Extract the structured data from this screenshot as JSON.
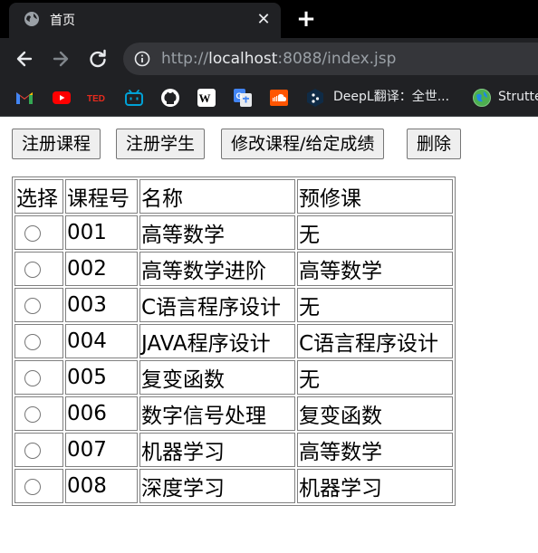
{
  "browser": {
    "tab_title": "首页",
    "tab_close": "✕",
    "new_tab": "+",
    "url_scheme": "http://",
    "url_host": "localhost",
    "url_rest": ":8088/index.jsp",
    "bookmarks": {
      "deepl_label": "DeepL翻译：全世...",
      "strutter_label": "Strutte"
    }
  },
  "page": {
    "buttons": {
      "register_course": "注册课程",
      "register_student": "注册学生",
      "modify_course": "修改课程/给定成绩",
      "delete": "删除"
    },
    "table": {
      "headers": [
        "选择",
        "课程号",
        "名称",
        "预修课"
      ],
      "rows": [
        {
          "id": "001",
          "name": "高等数学",
          "prereq": "无"
        },
        {
          "id": "002",
          "name": "高等数学进阶",
          "prereq": "高等数学"
        },
        {
          "id": "003",
          "name": "C语言程序设计",
          "prereq": "无"
        },
        {
          "id": "004",
          "name": "JAVA程序设计",
          "prereq": "C语言程序设计"
        },
        {
          "id": "005",
          "name": "复变函数",
          "prereq": "无"
        },
        {
          "id": "006",
          "name": "数字信号处理",
          "prereq": "复变函数"
        },
        {
          "id": "007",
          "name": "机器学习",
          "prereq": "高等数学"
        },
        {
          "id": "008",
          "name": "深度学习",
          "prereq": "机器学习"
        }
      ]
    }
  }
}
